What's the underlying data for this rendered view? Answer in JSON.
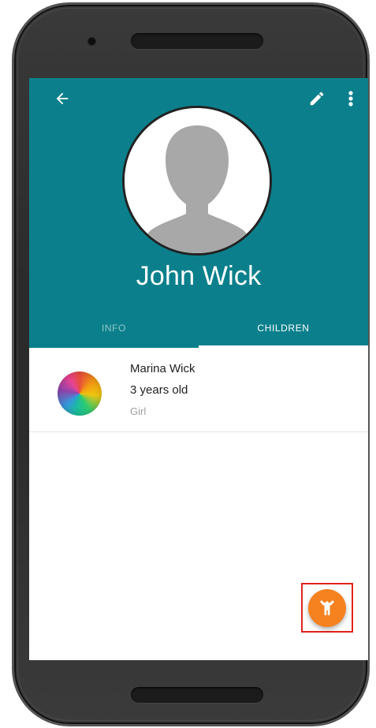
{
  "app_bar": {
    "back_icon": "arrow-back-icon",
    "edit_icon": "pencil-icon",
    "more_icon": "more-vert-icon"
  },
  "profile": {
    "name": "John Wick",
    "avatar_icon": "person-silhouette-icon"
  },
  "tabs": [
    {
      "label": "INFO",
      "selected": false
    },
    {
      "label": "CHILDREN",
      "selected": true
    }
  ],
  "children": [
    {
      "name": "Marina Wick",
      "age": "3 years old",
      "gender": "Girl",
      "avatar_icon": "colorful-circle-avatar"
    }
  ],
  "fab": {
    "icon": "child-figure-icon",
    "color": "#f5811f",
    "highlight_color": "#e2231a"
  },
  "colors": {
    "header": "#0b808c",
    "fab": "#f5811f"
  }
}
